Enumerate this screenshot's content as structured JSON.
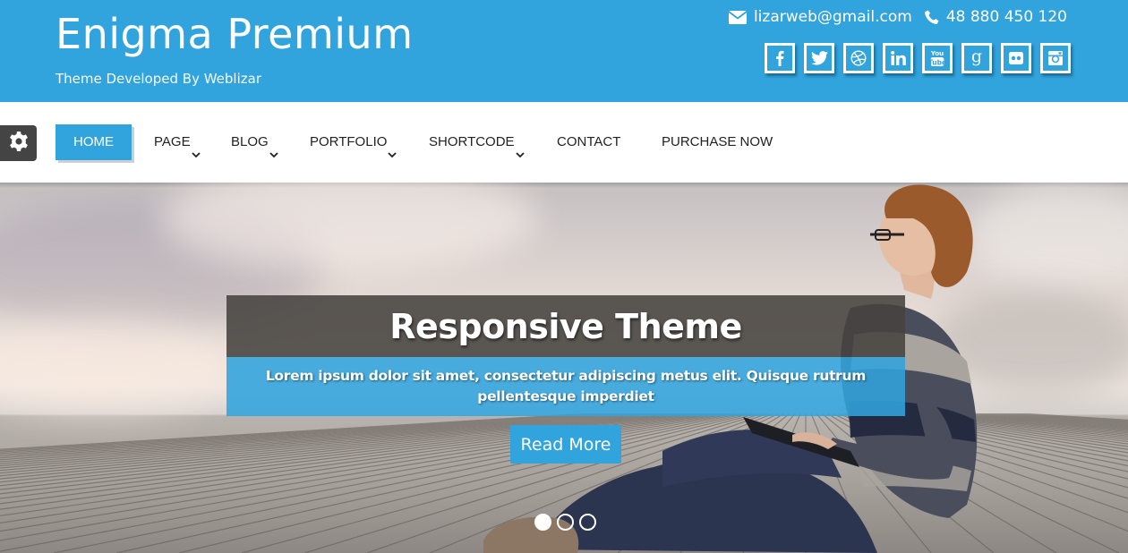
{
  "header": {
    "site_title": "Enigma Premium",
    "tagline": "Theme Developed By Weblizar",
    "brand_color": "#31a3dd",
    "contact": {
      "email_icon": "envelope-icon",
      "email": "lizarweb@gmail.com",
      "phone_icon": "phone-icon",
      "phone": "48 880 450 120"
    },
    "social": [
      {
        "name": "facebook",
        "icon": "facebook-icon"
      },
      {
        "name": "twitter",
        "icon": "twitter-icon"
      },
      {
        "name": "dribbble",
        "icon": "dribbble-icon"
      },
      {
        "name": "linkedin",
        "icon": "linkedin-icon"
      },
      {
        "name": "youtube",
        "icon": "youtube-icon"
      },
      {
        "name": "google-plus",
        "icon": "google-plus-icon"
      },
      {
        "name": "flickr",
        "icon": "flickr-icon"
      },
      {
        "name": "instagram",
        "icon": "instagram-icon"
      }
    ]
  },
  "nav": {
    "settings_icon": "gear-icon",
    "items": [
      {
        "label": "HOME",
        "active": true,
        "dropdown": false
      },
      {
        "label": "PAGE",
        "active": false,
        "dropdown": true
      },
      {
        "label": "BLOG",
        "active": false,
        "dropdown": true
      },
      {
        "label": "PORTFOLIO",
        "active": false,
        "dropdown": true
      },
      {
        "label": "SHORTCODE",
        "active": false,
        "dropdown": true
      },
      {
        "label": "CONTACT",
        "active": false,
        "dropdown": false
      },
      {
        "label": "PURCHASE NOW",
        "active": false,
        "dropdown": false
      }
    ]
  },
  "hero": {
    "slide_title": "Responsive Theme",
    "slide_description": "Lorem ipsum dolor sit amet, consectetur adipiscing metus elit. Quisque rutrum pellentesque imperdiet",
    "button_label": "Read More",
    "slides_total": 3,
    "active_slide": 1
  }
}
